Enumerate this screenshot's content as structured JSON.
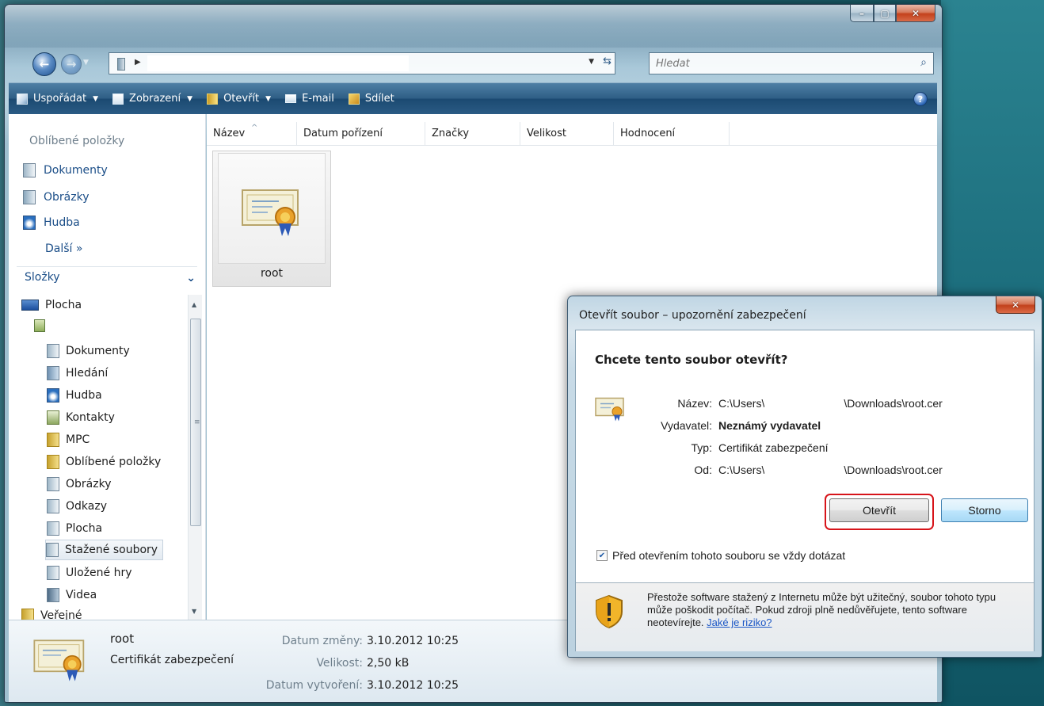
{
  "search": {
    "placeholder": "Hledat"
  },
  "toolbar": {
    "organize": "Uspořádat",
    "views": "Zobrazení",
    "open": "Otevřít",
    "email": "E-mail",
    "share": "Sdílet",
    "help": "?"
  },
  "nav": {
    "favorites_title": "Oblíbené položky",
    "favorites": [
      "Dokumenty",
      "Obrázky",
      "Hudba"
    ],
    "more": "Další »",
    "folders_title": "Složky",
    "tree": {
      "desktop": "Plocha",
      "items": [
        "Dokumenty",
        "Hledání",
        "Hudba",
        "Kontakty",
        "MPC",
        "Oblíbené položky",
        "Obrázky",
        "Odkazy",
        "Plocha",
        "Stažené soubory",
        "Uložené hry",
        "Videa"
      ],
      "public": "Veřejné",
      "selected": "Stažené soubory"
    }
  },
  "columns": [
    "Název",
    "Datum pořízení",
    "Značky",
    "Velikost",
    "Hodnocení"
  ],
  "files": [
    {
      "name": "root"
    }
  ],
  "details": {
    "name": "root",
    "type": "Certifikát zabezpečení",
    "modified_label": "Datum změny:",
    "modified_value": "3.10.2012 10:25",
    "size_label": "Velikost:",
    "size_value": "2,50 kB",
    "created_label": "Datum vytvoření:",
    "created_value": "3.10.2012 10:25"
  },
  "dialog": {
    "title": "Otevřít soubor – upozornění zabezpečení",
    "question": "Chcete tento soubor otevřít?",
    "name_label": "Název:",
    "name_prefix": "C:\\Users\\",
    "name_suffix": "\\Downloads\\root.cer",
    "publisher_label": "Vydavatel:",
    "publisher_value": "Neznámý vydavatel",
    "type_label": "Typ:",
    "type_value": "Certifikát zabezpečení",
    "from_label": "Od:",
    "from_prefix": "C:\\Users\\",
    "from_suffix": "\\Downloads\\root.cer",
    "open_button": "Otevřít",
    "cancel_button": "Storno",
    "checkbox_label": "Před otevřením tohoto souboru se vždy dotázat",
    "checkbox_checked": true,
    "warning_text": "Přestože software stažený z Internetu může být užitečný, soubor tohoto typu může poškodit počítač. Pokud zdroji plně nedůvěřujete, tento software neotevírejte.",
    "warning_link": "Jaké je riziko?"
  }
}
